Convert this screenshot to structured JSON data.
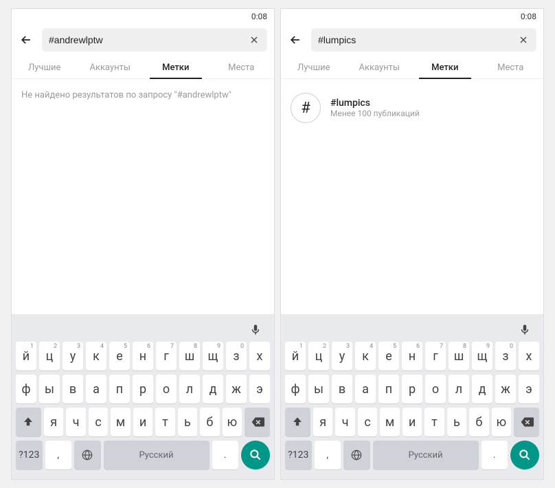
{
  "status_time": "0:08",
  "tabs": [
    "Лучшие",
    "Аккаунты",
    "Метки",
    "Места"
  ],
  "active_tab_index": 2,
  "left": {
    "search_value": "#andrewlptw",
    "no_results": "Не найдено результатов по запросу \"#andrewlptw\""
  },
  "right": {
    "search_value": "#lumpics",
    "result": {
      "tag": "#lumpics",
      "sub": "Менее 100 публикаций"
    }
  },
  "keyboard": {
    "row1": [
      {
        "l": "й",
        "s": "1"
      },
      {
        "l": "ц",
        "s": "2"
      },
      {
        "l": "у",
        "s": "3"
      },
      {
        "l": "к",
        "s": "4"
      },
      {
        "l": "е",
        "s": "5"
      },
      {
        "l": "н",
        "s": "6"
      },
      {
        "l": "г",
        "s": "7"
      },
      {
        "l": "ш",
        "s": "8"
      },
      {
        "l": "щ",
        "s": "9"
      },
      {
        "l": "з",
        "s": "0"
      },
      {
        "l": "х",
        "s": ""
      }
    ],
    "row2": [
      "ф",
      "ы",
      "в",
      "а",
      "п",
      "р",
      "о",
      "л",
      "д",
      "ж",
      "э"
    ],
    "row3": [
      "я",
      "ч",
      "с",
      "м",
      "и",
      "т",
      "ь",
      "б",
      "ю"
    ],
    "symbols": "?123",
    "comma": ",",
    "space": "Русский",
    "period": "."
  }
}
